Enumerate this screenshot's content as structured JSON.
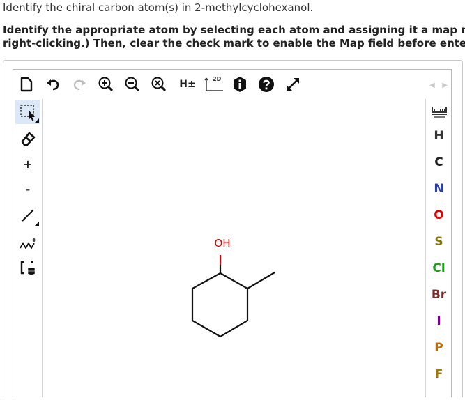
{
  "question": "Identify the chiral carbon atom(s) in 2-methylcyclohexanol.",
  "instructions": {
    "line1": "Identify the appropriate atom by selecting each atom and assigning it a map num",
    "line2": "right-clicking.) Then, clear the check mark to enable the Map field before enterin"
  },
  "toolbar": {
    "hydrogen_label": "H±",
    "clean_label": "2D"
  },
  "left_tools": {
    "plus_label": "+",
    "minus_label": "-"
  },
  "molecule": {
    "oh_label": "OH"
  },
  "elements": [
    {
      "symbol": "H",
      "color": "#333333"
    },
    {
      "symbol": "C",
      "color": "#222222"
    },
    {
      "symbol": "N",
      "color": "#2b3fa6"
    },
    {
      "symbol": "O",
      "color": "#e00000"
    },
    {
      "symbol": "S",
      "color": "#8a7400"
    },
    {
      "symbol": "Cl",
      "color": "#1e9a1e"
    },
    {
      "symbol": "Br",
      "color": "#7a2a2a"
    },
    {
      "symbol": "I",
      "color": "#7a00a0"
    },
    {
      "symbol": "P",
      "color": "#c06a00"
    },
    {
      "symbol": "F",
      "color": "#9a7a00"
    }
  ],
  "colors": {
    "accent": "#dce8f7",
    "oxygen": "#e00000"
  }
}
